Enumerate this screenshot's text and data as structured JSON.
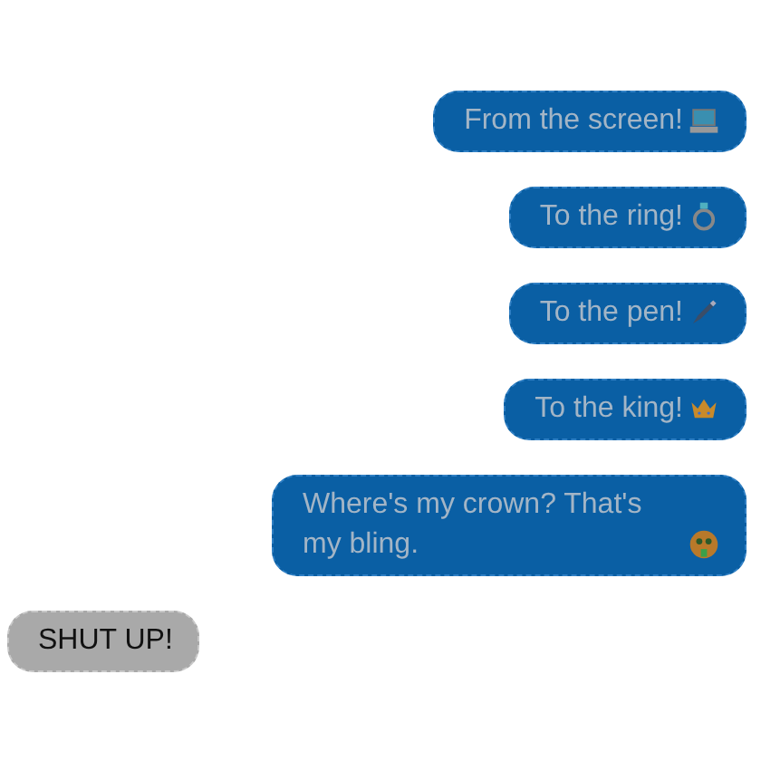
{
  "messages": [
    {
      "kind": "sent",
      "text": "From the screen!"
    },
    {
      "kind": "sent",
      "text": "To the ring!"
    },
    {
      "kind": "sent",
      "text": "To the pen!"
    },
    {
      "kind": "sent",
      "text": "To the king!"
    },
    {
      "kind": "sent",
      "text": "Where's my crown? That's my bling."
    },
    {
      "kind": "received",
      "text": "SHUT UP!"
    }
  ]
}
